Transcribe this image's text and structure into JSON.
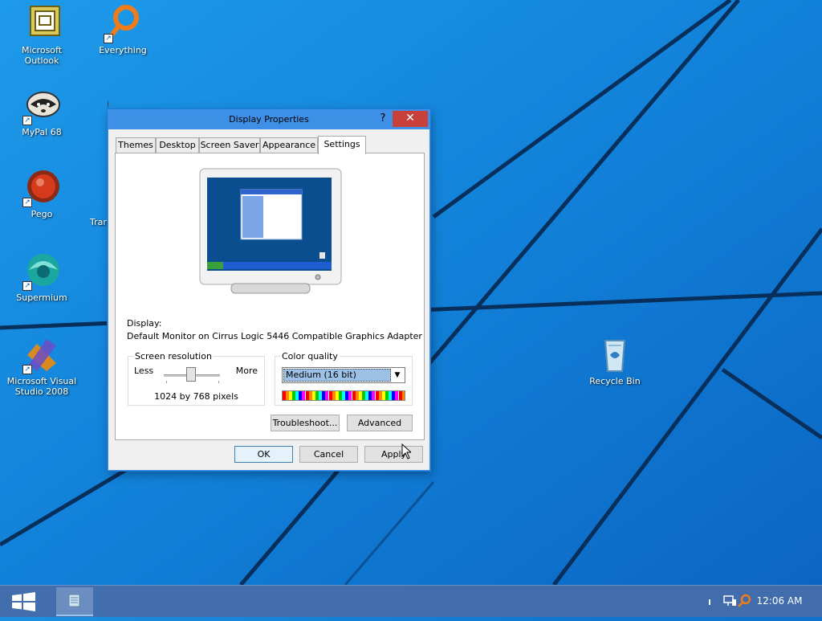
{
  "desktop": {
    "icons": [
      {
        "label": "Microsoft Outlook"
      },
      {
        "label": "Everything"
      },
      {
        "label": "MyPal 68"
      },
      {
        "label": "Pego"
      },
      {
        "label": "Tran"
      },
      {
        "label": "Supermium"
      },
      {
        "label": "Microsoft Visual Studio 2008"
      },
      {
        "label": "Recycle Bin"
      }
    ]
  },
  "dialog": {
    "title": "Display Properties",
    "help_glyph": "?",
    "close_glyph": "✕",
    "tabs": [
      "Themes",
      "Desktop",
      "Screen Saver",
      "Appearance",
      "Settings"
    ],
    "active_tab": "Settings",
    "display_label": "Display:",
    "display_value": "Default Monitor on Cirrus Logic 5446 Compatible Graphics Adapter",
    "resolution": {
      "legend": "Screen resolution",
      "less": "Less",
      "more": "More",
      "value": "1024 by 768 pixels",
      "slider_level": 0.5
    },
    "color_quality": {
      "legend": "Color quality",
      "selected": "Medium (16 bit)"
    },
    "buttons": {
      "troubleshoot": "Troubleshoot...",
      "advanced": "Advanced",
      "ok": "OK",
      "cancel": "Cancel",
      "apply": "Apply"
    }
  },
  "taskbar": {
    "clock": "12:06 AM"
  },
  "colors": {
    "wallpaper": "#0f77cf",
    "titlebar": "#3e8fe6",
    "close": "#c7413a",
    "taskbar": "#466eaa"
  }
}
